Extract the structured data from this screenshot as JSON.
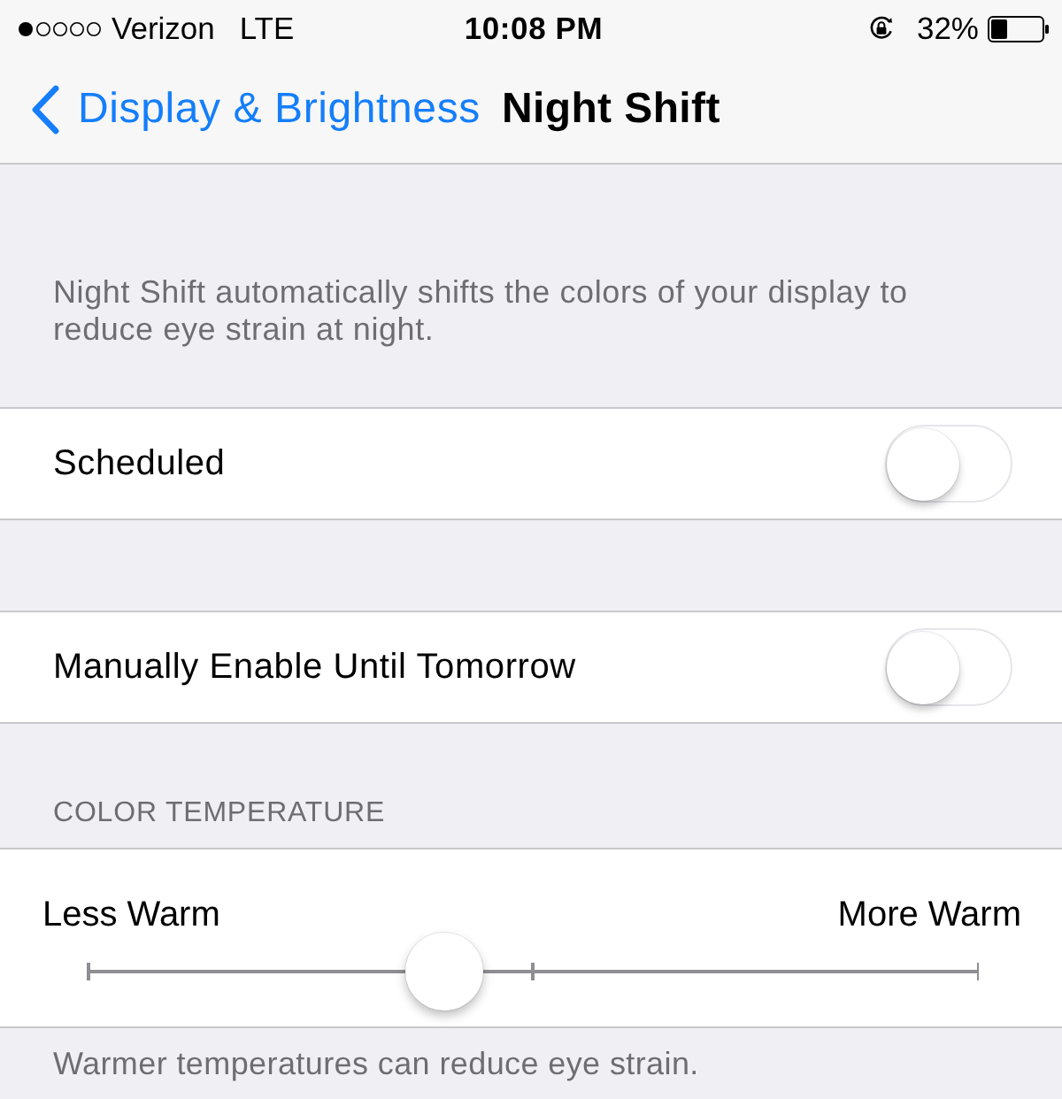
{
  "status_bar": {
    "carrier": "Verizon",
    "network": "LTE",
    "time": "10:08 PM",
    "battery": "32%"
  },
  "nav_bar": {
    "back_label": "Display & Brightness",
    "title": "Night Shift"
  },
  "description": "Night Shift automatically shifts the colors of your display to reduce eye strain at night.",
  "settings": [
    {
      "label": "Scheduled",
      "on": false
    },
    {
      "label": "Manually Enable Until Tomorrow",
      "on": false
    }
  ],
  "color_temperature": {
    "header": "COLOR TEMPERATURE",
    "min_label": "Less Warm",
    "max_label": "More Warm",
    "level": 0.4,
    "footer": "Warmer temperatures can reduce eye strain."
  }
}
